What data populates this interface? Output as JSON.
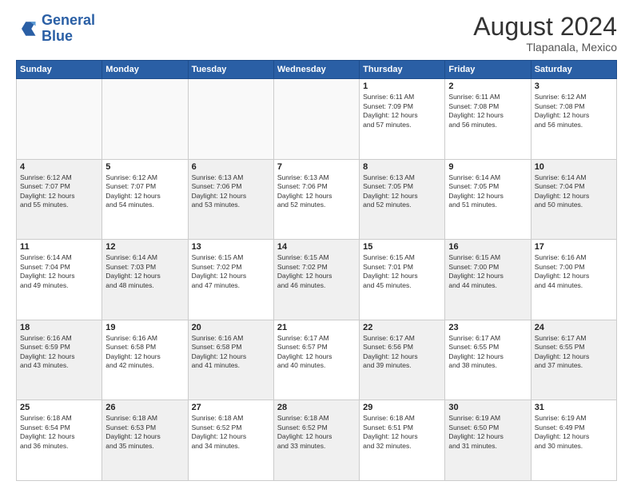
{
  "header": {
    "logo_line1": "General",
    "logo_line2": "Blue",
    "month_year": "August 2024",
    "location": "Tlapanala, Mexico"
  },
  "days_of_week": [
    "Sunday",
    "Monday",
    "Tuesday",
    "Wednesday",
    "Thursday",
    "Friday",
    "Saturday"
  ],
  "weeks": [
    [
      {
        "day": "",
        "text": "",
        "shaded": false,
        "empty": true
      },
      {
        "day": "",
        "text": "",
        "shaded": false,
        "empty": true
      },
      {
        "day": "",
        "text": "",
        "shaded": false,
        "empty": true
      },
      {
        "day": "",
        "text": "",
        "shaded": false,
        "empty": true
      },
      {
        "day": "1",
        "text": "Sunrise: 6:11 AM\nSunset: 7:09 PM\nDaylight: 12 hours\nand 57 minutes.",
        "shaded": false,
        "empty": false
      },
      {
        "day": "2",
        "text": "Sunrise: 6:11 AM\nSunset: 7:08 PM\nDaylight: 12 hours\nand 56 minutes.",
        "shaded": false,
        "empty": false
      },
      {
        "day": "3",
        "text": "Sunrise: 6:12 AM\nSunset: 7:08 PM\nDaylight: 12 hours\nand 56 minutes.",
        "shaded": false,
        "empty": false
      }
    ],
    [
      {
        "day": "4",
        "text": "Sunrise: 6:12 AM\nSunset: 7:07 PM\nDaylight: 12 hours\nand 55 minutes.",
        "shaded": true,
        "empty": false
      },
      {
        "day": "5",
        "text": "Sunrise: 6:12 AM\nSunset: 7:07 PM\nDaylight: 12 hours\nand 54 minutes.",
        "shaded": false,
        "empty": false
      },
      {
        "day": "6",
        "text": "Sunrise: 6:13 AM\nSunset: 7:06 PM\nDaylight: 12 hours\nand 53 minutes.",
        "shaded": true,
        "empty": false
      },
      {
        "day": "7",
        "text": "Sunrise: 6:13 AM\nSunset: 7:06 PM\nDaylight: 12 hours\nand 52 minutes.",
        "shaded": false,
        "empty": false
      },
      {
        "day": "8",
        "text": "Sunrise: 6:13 AM\nSunset: 7:05 PM\nDaylight: 12 hours\nand 52 minutes.",
        "shaded": true,
        "empty": false
      },
      {
        "day": "9",
        "text": "Sunrise: 6:14 AM\nSunset: 7:05 PM\nDaylight: 12 hours\nand 51 minutes.",
        "shaded": false,
        "empty": false
      },
      {
        "day": "10",
        "text": "Sunrise: 6:14 AM\nSunset: 7:04 PM\nDaylight: 12 hours\nand 50 minutes.",
        "shaded": true,
        "empty": false
      }
    ],
    [
      {
        "day": "11",
        "text": "Sunrise: 6:14 AM\nSunset: 7:04 PM\nDaylight: 12 hours\nand 49 minutes.",
        "shaded": false,
        "empty": false
      },
      {
        "day": "12",
        "text": "Sunrise: 6:14 AM\nSunset: 7:03 PM\nDaylight: 12 hours\nand 48 minutes.",
        "shaded": true,
        "empty": false
      },
      {
        "day": "13",
        "text": "Sunrise: 6:15 AM\nSunset: 7:02 PM\nDaylight: 12 hours\nand 47 minutes.",
        "shaded": false,
        "empty": false
      },
      {
        "day": "14",
        "text": "Sunrise: 6:15 AM\nSunset: 7:02 PM\nDaylight: 12 hours\nand 46 minutes.",
        "shaded": true,
        "empty": false
      },
      {
        "day": "15",
        "text": "Sunrise: 6:15 AM\nSunset: 7:01 PM\nDaylight: 12 hours\nand 45 minutes.",
        "shaded": false,
        "empty": false
      },
      {
        "day": "16",
        "text": "Sunrise: 6:15 AM\nSunset: 7:00 PM\nDaylight: 12 hours\nand 44 minutes.",
        "shaded": true,
        "empty": false
      },
      {
        "day": "17",
        "text": "Sunrise: 6:16 AM\nSunset: 7:00 PM\nDaylight: 12 hours\nand 44 minutes.",
        "shaded": false,
        "empty": false
      }
    ],
    [
      {
        "day": "18",
        "text": "Sunrise: 6:16 AM\nSunset: 6:59 PM\nDaylight: 12 hours\nand 43 minutes.",
        "shaded": true,
        "empty": false
      },
      {
        "day": "19",
        "text": "Sunrise: 6:16 AM\nSunset: 6:58 PM\nDaylight: 12 hours\nand 42 minutes.",
        "shaded": false,
        "empty": false
      },
      {
        "day": "20",
        "text": "Sunrise: 6:16 AM\nSunset: 6:58 PM\nDaylight: 12 hours\nand 41 minutes.",
        "shaded": true,
        "empty": false
      },
      {
        "day": "21",
        "text": "Sunrise: 6:17 AM\nSunset: 6:57 PM\nDaylight: 12 hours\nand 40 minutes.",
        "shaded": false,
        "empty": false
      },
      {
        "day": "22",
        "text": "Sunrise: 6:17 AM\nSunset: 6:56 PM\nDaylight: 12 hours\nand 39 minutes.",
        "shaded": true,
        "empty": false
      },
      {
        "day": "23",
        "text": "Sunrise: 6:17 AM\nSunset: 6:55 PM\nDaylight: 12 hours\nand 38 minutes.",
        "shaded": false,
        "empty": false
      },
      {
        "day": "24",
        "text": "Sunrise: 6:17 AM\nSunset: 6:55 PM\nDaylight: 12 hours\nand 37 minutes.",
        "shaded": true,
        "empty": false
      }
    ],
    [
      {
        "day": "25",
        "text": "Sunrise: 6:18 AM\nSunset: 6:54 PM\nDaylight: 12 hours\nand 36 minutes.",
        "shaded": false,
        "empty": false
      },
      {
        "day": "26",
        "text": "Sunrise: 6:18 AM\nSunset: 6:53 PM\nDaylight: 12 hours\nand 35 minutes.",
        "shaded": true,
        "empty": false
      },
      {
        "day": "27",
        "text": "Sunrise: 6:18 AM\nSunset: 6:52 PM\nDaylight: 12 hours\nand 34 minutes.",
        "shaded": false,
        "empty": false
      },
      {
        "day": "28",
        "text": "Sunrise: 6:18 AM\nSunset: 6:52 PM\nDaylight: 12 hours\nand 33 minutes.",
        "shaded": true,
        "empty": false
      },
      {
        "day": "29",
        "text": "Sunrise: 6:18 AM\nSunset: 6:51 PM\nDaylight: 12 hours\nand 32 minutes.",
        "shaded": false,
        "empty": false
      },
      {
        "day": "30",
        "text": "Sunrise: 6:19 AM\nSunset: 6:50 PM\nDaylight: 12 hours\nand 31 minutes.",
        "shaded": true,
        "empty": false
      },
      {
        "day": "31",
        "text": "Sunrise: 6:19 AM\nSunset: 6:49 PM\nDaylight: 12 hours\nand 30 minutes.",
        "shaded": false,
        "empty": false
      }
    ]
  ]
}
